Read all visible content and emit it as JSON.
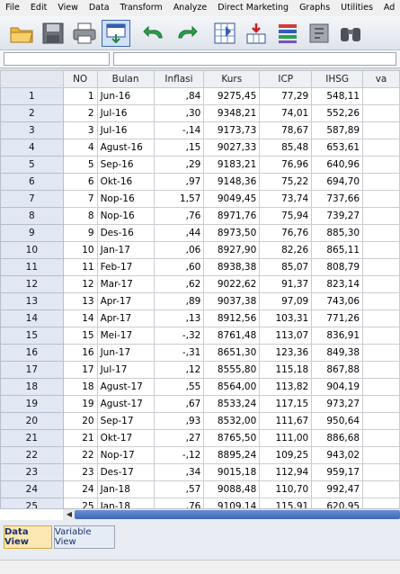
{
  "menu": [
    "File",
    "Edit",
    "View",
    "Data",
    "Transform",
    "Analyze",
    "Direct Marketing",
    "Graphs",
    "Utilities",
    "Ad"
  ],
  "menu_underline": [
    "F",
    "E",
    "V",
    "D",
    "T",
    "A",
    "M",
    "G",
    "U",
    "A"
  ],
  "toolbar": {
    "icons": [
      "open-folder-icon",
      "save-icon",
      "print-icon",
      "dialog-recall-icon",
      "undo-icon",
      "redo-icon",
      "goto-case-icon",
      "goto-variable-icon",
      "variables-icon",
      "find-icon",
      "binoculars-icon"
    ]
  },
  "grid": {
    "columns": [
      "NO",
      "Bulan",
      "Inflasi",
      "Kurs",
      "ICP",
      "IHSG",
      "va"
    ],
    "rows": [
      [
        "1",
        "1",
        "Jun-16",
        ",84",
        "9275,45",
        "77,29",
        "548,11"
      ],
      [
        "2",
        "2",
        "Jul-16",
        ",30",
        "9348,21",
        "74,01",
        "552,26"
      ],
      [
        "3",
        "3",
        "Jul-16",
        "-,14",
        "9173,73",
        "78,67",
        "587,89"
      ],
      [
        "4",
        "4",
        "Agust-16",
        ",15",
        "9027,33",
        "85,48",
        "653,61"
      ],
      [
        "5",
        "5",
        "Sep-16",
        ",29",
        "9183,21",
        "76,96",
        "640,96"
      ],
      [
        "6",
        "6",
        "Okt-16",
        ",97",
        "9148,36",
        "75,22",
        "694,70"
      ],
      [
        "7",
        "7",
        "Nop-16",
        "1,57",
        "9049,45",
        "73,74",
        "737,66"
      ],
      [
        "8",
        "8",
        "Nop-16",
        ",76",
        "8971,76",
        "75,94",
        "739,27"
      ],
      [
        "9",
        "9",
        "Des-16",
        ",44",
        "8973,50",
        "76,76",
        "885,30"
      ],
      [
        "10",
        "10",
        "Jan-17",
        ",06",
        "8927,90",
        "82,26",
        "865,11"
      ],
      [
        "11",
        "11",
        "Feb-17",
        ",60",
        "8938,38",
        "85,07",
        "808,79"
      ],
      [
        "12",
        "12",
        "Mar-17",
        ",62",
        "9022,62",
        "91,37",
        "823,14"
      ],
      [
        "13",
        "13",
        "Apr-17",
        ",89",
        "9037,38",
        "97,09",
        "743,06"
      ],
      [
        "14",
        "14",
        "Apr-17",
        ",13",
        "8912,56",
        "103,31",
        "771,26"
      ],
      [
        "15",
        "15",
        "Mei-17",
        "-,32",
        "8761,48",
        "113,07",
        "836,91"
      ],
      [
        "16",
        "16",
        "Jun-17",
        "-,31",
        "8651,30",
        "123,36",
        "849,38"
      ],
      [
        "17",
        "17",
        "Jul-17",
        ",12",
        "8555,80",
        "115,18",
        "867,88"
      ],
      [
        "18",
        "18",
        "Agust-17",
        ",55",
        "8564,00",
        "113,82",
        "904,19"
      ],
      [
        "19",
        "19",
        "Agust-17",
        ",67",
        "8533,24",
        "117,15",
        "973,27"
      ],
      [
        "20",
        "20",
        "Sep-17",
        ",93",
        "8532,00",
        "111,67",
        "950,64"
      ],
      [
        "21",
        "21",
        "Okt-17",
        ",27",
        "8765,50",
        "111,00",
        "886,68"
      ],
      [
        "22",
        "22",
        "Nop-17",
        "-,12",
        "8895,24",
        "109,25",
        "943,02"
      ],
      [
        "23",
        "23",
        "Des-17",
        ",34",
        "9015,18",
        "112,94",
        "959,17"
      ],
      [
        "24",
        "24",
        "Jan-18",
        ",57",
        "9088,48",
        "110,70",
        "992,47"
      ],
      [
        "25",
        "25",
        "Jan-18",
        ",76",
        "9109,14",
        "115,91",
        "620,95"
      ]
    ]
  },
  "tabs": {
    "data_view": "Data View",
    "variable_view": "Variable View"
  }
}
